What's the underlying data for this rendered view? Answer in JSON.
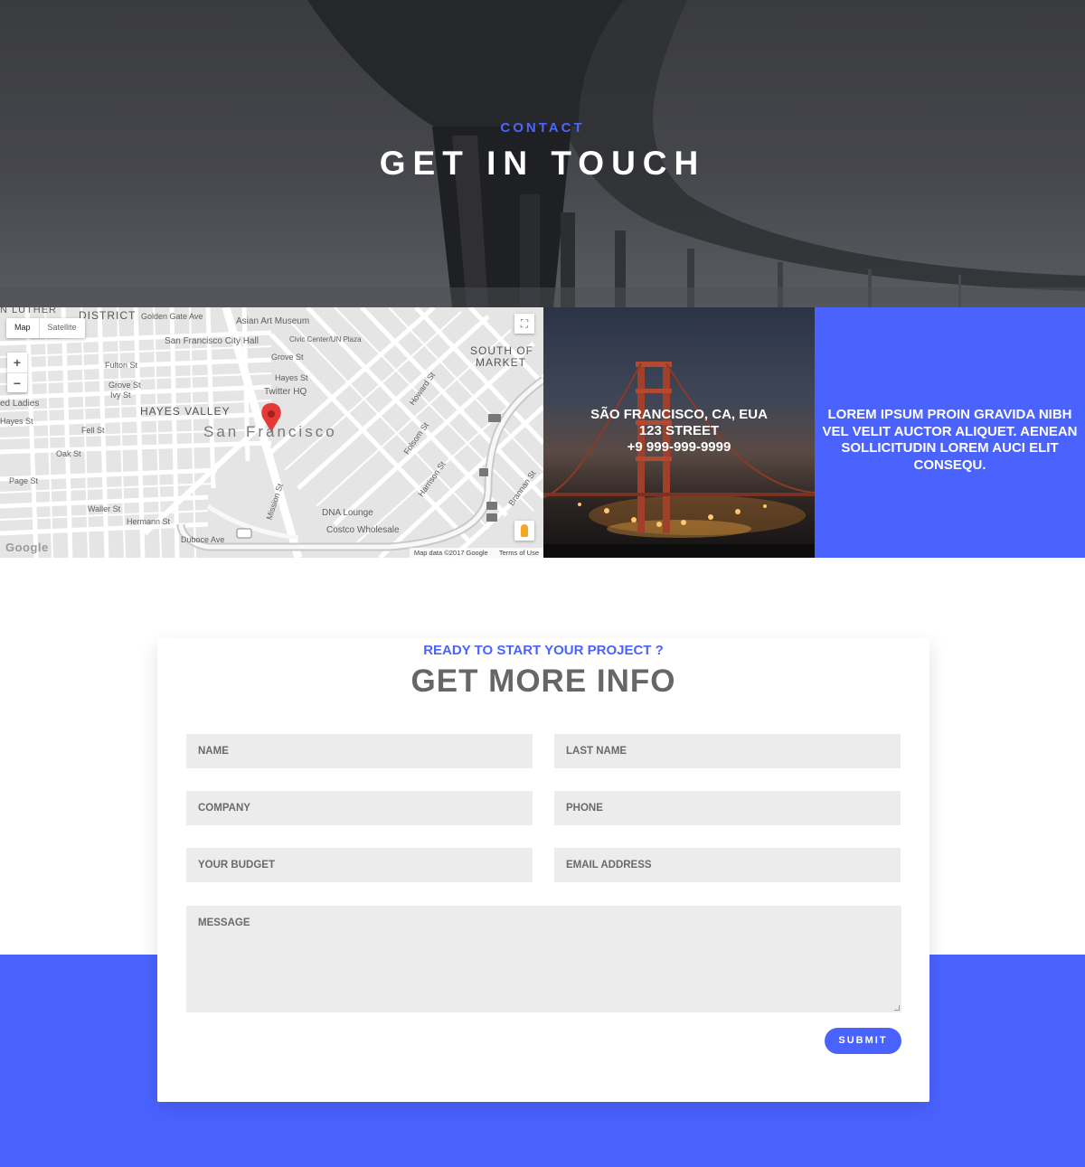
{
  "hero": {
    "eyebrow": "CONTACT",
    "title": "GET IN TOUCH"
  },
  "map": {
    "tabs": [
      "Map",
      "Satellite"
    ],
    "zoom_in": "+",
    "zoom_out": "−",
    "labels": {
      "district": "DISTRICT",
      "luther": "N LUTHER",
      "golden_gate": "Golden Gate Ave",
      "asian_art": "Asian Art Museum",
      "city_hall": "San Francisco City Hall",
      "civic_center": "Civic Center/UN Plaza",
      "south_market_1": "SOUTH OF",
      "south_market_2": "MARKET",
      "fulton": "Fulton St",
      "grove": "Grove St",
      "ivy": "Ivy St",
      "hayes": "Hayes St",
      "twitter": "Twitter HQ",
      "hayes_valley": "HAYES VALLEY",
      "san_francisco": "San Francisco",
      "painted_ladies": "ed Ladies",
      "fell": "Fell St",
      "oak": "Oak St",
      "page": "Page St",
      "waller": "Waller St",
      "hermann": "Hermann St",
      "duboce": "Duboce Ave",
      "dna": "DNA Lounge",
      "costco": "Costco Wholesale",
      "mission": "Mission St",
      "folsom": "Folsom St",
      "howard": "Howard St",
      "harrison": "Harrison St",
      "brannan": "Brannan St"
    },
    "google": "Google",
    "attribution": [
      "Map data ©2017 Google",
      "Terms of Use"
    ]
  },
  "location": {
    "line1": "SÃO FRANCISCO, CA, EUA",
    "line2": "123 STREET",
    "line3": "+9 999-999-9999"
  },
  "lorem_card": {
    "lines": [
      "LOREM IPSUM PROIN GRAVIDA NIBH",
      "VEL VELIT AUCTOR ALIQUET. AENEAN",
      "SOLLICITUDIN LOREM AUCI ELIT",
      "CONSEQU."
    ]
  },
  "form": {
    "eyebrow": "READY TO START YOUR PROJECT ?",
    "title": "GET MORE INFO",
    "fields": {
      "name": "NAME",
      "last_name": "LAST NAME",
      "company": "COMPANY",
      "phone": "PHONE",
      "budget": "YOUR BUDGET",
      "email": "EMAIL ADDRESS",
      "message": "MESSAGE"
    },
    "submit": "SUBMIT"
  },
  "colors": {
    "accent": "#4a63ff",
    "field_bg": "#ececec",
    "hero_overlay": "#46474c"
  }
}
